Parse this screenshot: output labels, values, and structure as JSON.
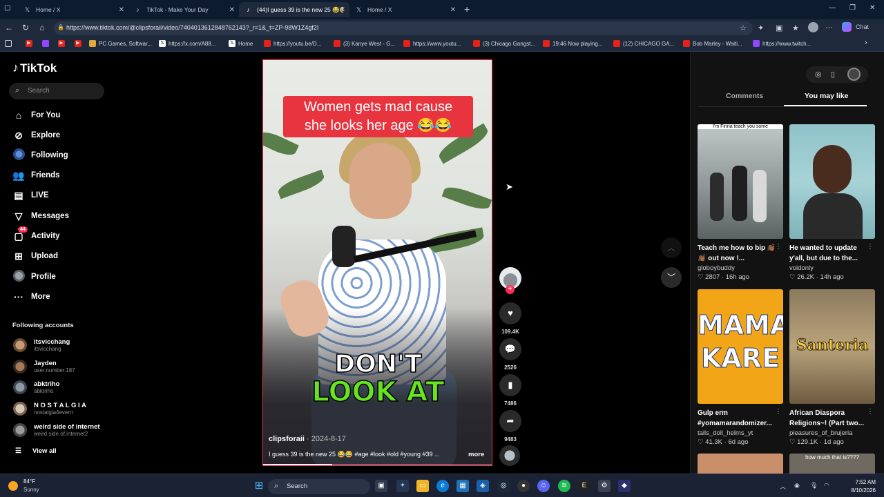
{
  "browser": {
    "tabs": [
      {
        "label": "Home / X",
        "icon": "x-logo"
      },
      {
        "label": "TikTok - Make Your Day",
        "icon": "tiktok-logo"
      },
      {
        "label": "(44)I guess 39 is the new 25 😂😂",
        "icon": "tiktok-logo",
        "active": true
      },
      {
        "label": "Home / X",
        "icon": "x-logo"
      }
    ],
    "new_tab": "+",
    "url": "https://www.tiktok.com/@clipsforaii/video/7404013612848762143?_r=1&_t=ZP-98W1Z4gf2I",
    "bookmarks": [
      {
        "label": "",
        "icon": "youtube"
      },
      {
        "label": "",
        "icon": "twitch"
      },
      {
        "label": "",
        "icon": "youtube"
      },
      {
        "label": "",
        "icon": "youtube"
      },
      {
        "label": "PC Games, Softwar...",
        "icon": "game"
      },
      {
        "label": "https://x.com/A88...",
        "icon": "x"
      },
      {
        "label": "Home",
        "icon": "x"
      },
      {
        "label": "https://youtu.be/D...",
        "icon": "youtube"
      },
      {
        "label": "(3) Kanye West - G...",
        "icon": "youtube"
      },
      {
        "label": "https://www.youtu...",
        "icon": "youtube"
      },
      {
        "label": "(3) Chicago Gangst...",
        "icon": "youtube"
      },
      {
        "label": "19:46 Now playing...",
        "icon": "youtube"
      },
      {
        "label": "(12) CHICAGO GA...",
        "icon": "youtube"
      },
      {
        "label": "Bob Marley - Waiti...",
        "icon": "youtube"
      },
      {
        "label": "https://www.twitch...",
        "icon": "twitch"
      }
    ],
    "chat_label": "Chat"
  },
  "sidebar": {
    "logo": "TikTok",
    "search_placeholder": "Search",
    "nav": [
      {
        "label": "For You",
        "icon": "home-icon"
      },
      {
        "label": "Explore",
        "icon": "compass-icon"
      },
      {
        "label": "Following",
        "icon": "following-avatar-icon"
      },
      {
        "label": "Friends",
        "icon": "friends-icon"
      },
      {
        "label": "LIVE",
        "icon": "live-icon"
      },
      {
        "label": "Messages",
        "icon": "messages-icon"
      },
      {
        "label": "Activity",
        "icon": "activity-icon",
        "badge": "44"
      },
      {
        "label": "Upload",
        "icon": "upload-icon"
      },
      {
        "label": "Profile",
        "icon": "profile-avatar-icon"
      },
      {
        "label": "More",
        "icon": "more-icon"
      }
    ],
    "following_heading": "Following accounts",
    "accounts": [
      {
        "name": "itsvicchang",
        "user": "itsvicchang"
      },
      {
        "name": "Jayden",
        "user": "user.number.187"
      },
      {
        "name": "abktriho",
        "user": "abktriho"
      },
      {
        "name": "N O S T A L G I A",
        "user": "nostalgia4everrr"
      },
      {
        "name": "weird side of internet",
        "user": "weird.side.of.internet2"
      }
    ],
    "view_all": "View all"
  },
  "video": {
    "caption_line1": "Women gets mad cause",
    "caption_line2": "she looks her age 😂😂",
    "overlay_line1": "DON'T",
    "overlay_line2": "LOOK AT",
    "author": "clipsforaii",
    "date": "2024-8-17",
    "description": "I guess 39 is the new 25 😂😂 #age #look #old #young #39 ...",
    "more": "more",
    "progress": 0.3
  },
  "actions": {
    "likes": "109.4K",
    "comments": "2526",
    "saves": "7486",
    "shares": "9483"
  },
  "right_panel": {
    "tabs": [
      "Comments",
      "You may like"
    ],
    "active_tab": "You may like",
    "cards": [
      {
        "title": "Teach me how to bip 👏🏾👏🏾 out now !...",
        "user": "globoybuddy",
        "likes": "2807",
        "age": "16h ago",
        "thumb_text": "I'm Finna teach you some"
      },
      {
        "title": "He wanted to update y'all, but due to the...",
        "user": "voidonly",
        "likes": "26.2K",
        "age": "14h ago",
        "thumb_text": ""
      },
      {
        "title": "Gulp erm #yomamarandomizer...",
        "user": "tails_doll_helms_yt",
        "likes": "41.3K",
        "age": "6d ago",
        "thumb_text": "MAMA KARE"
      },
      {
        "title": "African Diaspora Religions~! (Part two...",
        "user": "pleasures_of_brujeria",
        "likes": "129.1K",
        "age": "1d ago",
        "thumb_text": "Santeria"
      },
      {
        "thumb_text": "how much that is????"
      }
    ]
  },
  "taskbar": {
    "temp": "84°F",
    "condition": "Sunny",
    "search": "Search",
    "time": "7:52 AM",
    "date": "8/10/2026"
  }
}
